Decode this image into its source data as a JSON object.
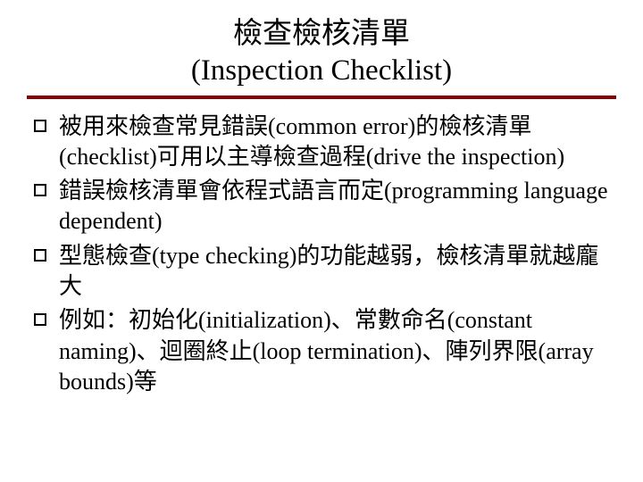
{
  "title": {
    "line1": "檢查檢核清單",
    "line2": "(Inspection Checklist)"
  },
  "items": [
    "被用來檢查常見錯誤(common error)的檢核清單(checklist)可用以主導檢查過程(drive the inspection)",
    "錯誤檢核清單會依程式語言而定(programming language dependent)",
    "型態檢查(type checking)的功能越弱，檢核清單就越龐大",
    "例如：初始化(initialization)、常數命名(constant naming)、迴圈終止(loop termination)、陣列界限(array bounds)等"
  ]
}
